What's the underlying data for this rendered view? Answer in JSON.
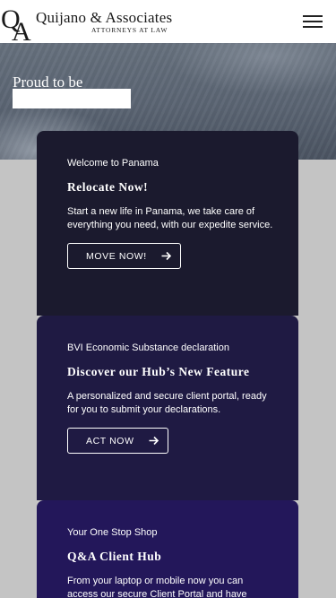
{
  "header": {
    "logo_mark_text": "QA",
    "brand_name": "Quijano & Associates",
    "brand_tagline": "ATTORNEYS AT LAW",
    "menu_icon": "hamburger-menu-icon"
  },
  "hero": {
    "text": "Proud to be",
    "typed_text": ""
  },
  "cards": [
    {
      "eyebrow": "Welcome to  Panama",
      "title": "Relocate Now!",
      "body": "Start a new life in  Panama, we take care of everything you need, with our expedite service.",
      "button_label": "MOVE NOW!",
      "button_icon": "arrow-right-icon"
    },
    {
      "eyebrow": "BVI  Economic Substance declaration",
      "title": "Discover our Hub’s New Feature",
      "body": "A personalized and secure client portal, ready for you to submit your declarations.",
      "button_label": "ACT  NOW",
      "button_icon": "arrow-right-icon"
    },
    {
      "eyebrow": "Your One Stop Shop",
      "title": "Q&A Client Hub",
      "body": "From your laptop or mobile now you can access our secure Client  Portal and have"
    }
  ],
  "colors": {
    "card1_bg": "#1b1a2e",
    "card2_bg": "#1f1a43",
    "card3_bg": "#23175a",
    "page_bg": "#c4c4c4"
  }
}
